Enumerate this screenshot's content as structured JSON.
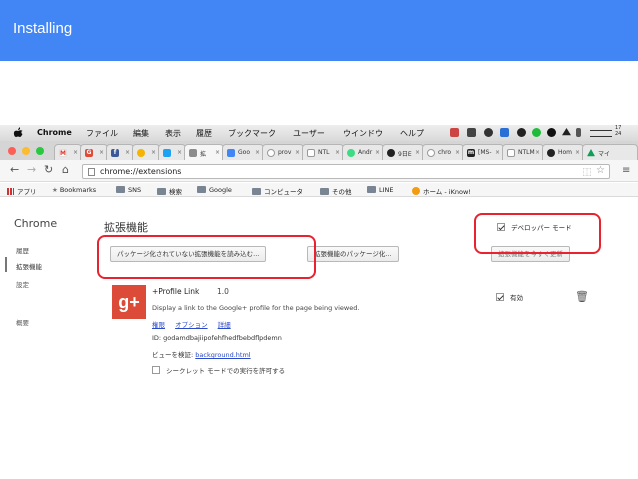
{
  "slide": {
    "title": "Installing"
  },
  "menubar": {
    "app_name": "Chrome",
    "items": [
      "ファイル",
      "編集",
      "表示",
      "履歴",
      "ブックマーク",
      "ユーザー",
      "ウインドウ",
      "ヘルプ"
    ],
    "clock": "17\n24"
  },
  "tabs": [
    {
      "favicon": "M",
      "label": ""
    },
    {
      "favicon": "G",
      "label": ""
    },
    {
      "favicon": "f",
      "label": ""
    },
    {
      "favicon": "",
      "label": ""
    },
    {
      "favicon": "",
      "label": ""
    },
    {
      "favicon": "",
      "label": "拡"
    },
    {
      "favicon": "",
      "label": "Goo"
    },
    {
      "favicon": "",
      "label": "prov"
    },
    {
      "favicon": "",
      "label": "NTL"
    },
    {
      "favicon": "",
      "label": "Andr"
    },
    {
      "favicon": "",
      "label": "9日E"
    },
    {
      "favicon": "",
      "label": "chro"
    },
    {
      "favicon": "m",
      "label": "[MS-"
    },
    {
      "favicon": "",
      "label": "NTLM"
    },
    {
      "favicon": "",
      "label": "Hom"
    },
    {
      "favicon": "",
      "label": "マイ"
    }
  ],
  "toolbar": {
    "url": "chrome://extensions"
  },
  "bookmarks": {
    "apps": "アプリ",
    "items": [
      "Bookmarks",
      "SNS",
      "検索",
      "Google",
      "コンピュータ",
      "その他",
      "LINE",
      "ホーム - iKnow!"
    ]
  },
  "sidebar": {
    "title": "Chrome",
    "items": [
      "履歴",
      "拡張機能",
      "設定",
      "概要"
    ]
  },
  "extensions_page": {
    "title": "拡張機能",
    "developer_mode_label": "デベロッパー モード",
    "load_unpacked_label": "パッケージ化されていない拡張機能を読み込む...",
    "pack_label": "拡張機能のパッケージ化...",
    "update_label": "拡張機能を今すぐ更新"
  },
  "extension": {
    "logo_text": "g+",
    "name": "+Profile Link",
    "version": "1.0",
    "description": "Display a link to the Google+ profile for the page being viewed.",
    "permissions_link": "権限",
    "options_link": "オプション",
    "details_link": "詳細",
    "id_label": "ID: godamdbajiipofehfhedfbebdflpdemn",
    "inspect_label": "ビューを検証:",
    "inspect_link": "background.html",
    "incognito_label": "シークレット モードでの実行を許可する",
    "enabled_label": "有効"
  },
  "colors": {
    "header": "#4285f4",
    "highlight": "#e8232f",
    "link": "#2a49c8",
    "gplus": "#dc4a38"
  }
}
